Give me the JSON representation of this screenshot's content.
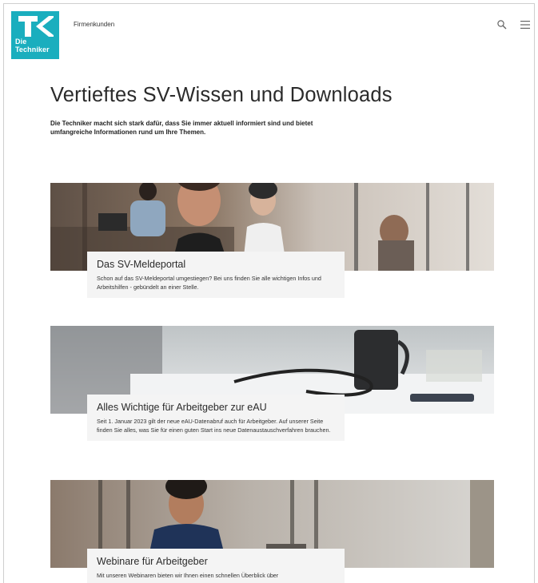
{
  "header": {
    "logo_line1": "Die",
    "logo_line2": "Techniker",
    "nav_link": "Firmenkunden"
  },
  "intro": {
    "title": "Vertieftes SV-Wissen und Downloads",
    "text": "Die Techniker macht sich stark dafür, dass Sie immer aktuell informiert sind und bietet umfangreiche Informationen rund um Ihre Themen."
  },
  "cards": [
    {
      "title": "Das SV-Meldeportal",
      "text": "Schon auf das SV-Meldeportal umgestiegen? Bei uns finden Sie alle wichtigen Infos und Arbeitshilfen - gebündelt an einer Stelle."
    },
    {
      "title": "Alles Wichtige für Arbeitgeber zur eAU",
      "text": "Seit 1. Januar 2023 gilt der neue eAU-Datenabruf auch für Arbeitgeber. Auf unserer Seite finden Sie alles, was Sie für einen guten Start ins neue Datenaustauschverfahren brauchen."
    },
    {
      "title": "Webinare für Arbeitgeber",
      "text": "Mit unseren Webinaren bieten wir Ihnen einen schnellen Überblick über"
    }
  ],
  "colors": {
    "brand": "#1aaebe",
    "card_box": "#f4f4f4"
  },
  "icons": {
    "search": "search-icon",
    "menu": "menu-icon"
  }
}
